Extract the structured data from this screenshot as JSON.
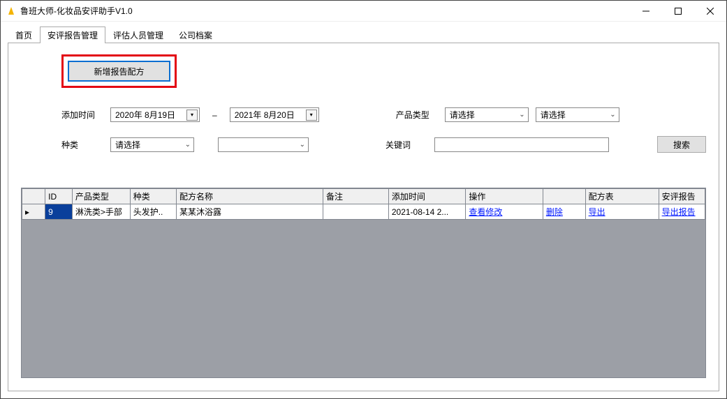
{
  "window": {
    "title": "鲁班大师-化妆品安评助手V1.0"
  },
  "tabs": {
    "items": [
      {
        "label": "首页"
      },
      {
        "label": "安评报告管理"
      },
      {
        "label": "评估人员管理"
      },
      {
        "label": "公司档案"
      }
    ],
    "active_index": 1
  },
  "toolbar": {
    "new_report_label": "新增报告配方"
  },
  "filters": {
    "add_time_label": "添加时间",
    "date_from": "2020年 8月19日",
    "date_to": "2021年 8月20日",
    "date_sep": "–",
    "product_type_label": "产品类型",
    "product_type_value": "请选择",
    "product_subtype_value": "请选择",
    "kind_label": "种类",
    "kind_value": "请选择",
    "kind_sub_value": "",
    "keyword_label": "关键词",
    "keyword_value": "",
    "search_label": "搜索"
  },
  "grid": {
    "headers": {
      "id": "ID",
      "product_type": "产品类型",
      "kind": "种类",
      "recipe_name": "配方名称",
      "remark": "备注",
      "add_time": "添加时间",
      "operate": "操作",
      "delete": "",
      "recipe_table": "配方表",
      "report": "安评报告"
    },
    "rows": [
      {
        "row_indicator": "▸",
        "id": "9",
        "product_type": "淋洗类>手部",
        "kind": "头发护..",
        "recipe_name": "某某沐浴露",
        "remark": "",
        "add_time": "2021-08-14 2...",
        "view_label": "查看修改",
        "delete_label": "删除",
        "export_label": "导出",
        "report_label": "导出报告"
      }
    ]
  }
}
